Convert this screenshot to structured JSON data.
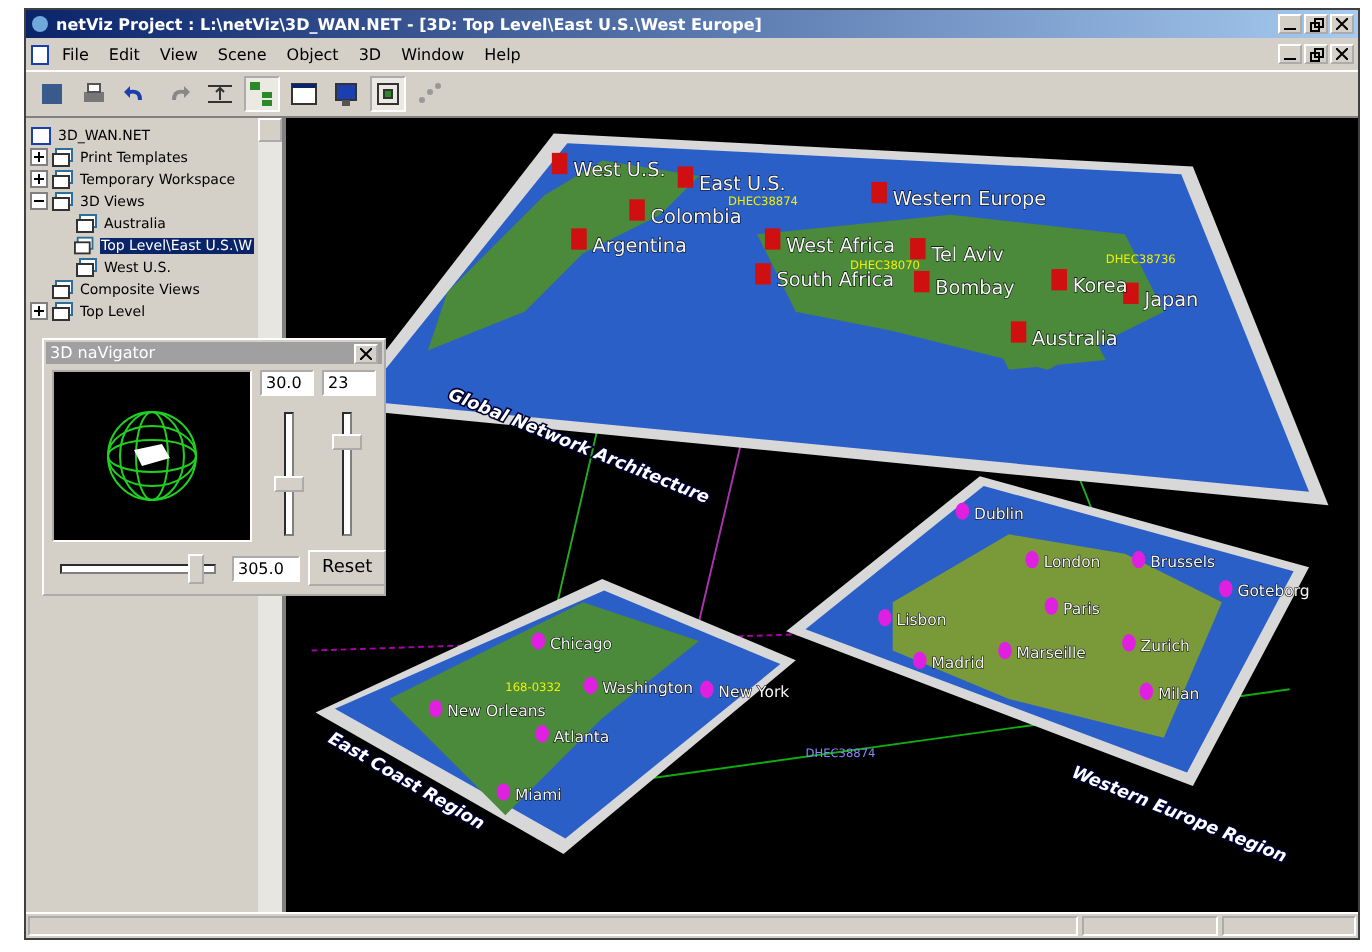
{
  "window": {
    "title": "netViz Project : L:\\netViz\\3D_WAN.NET - [3D: Top Level\\East U.S.\\West Europe]"
  },
  "menu": [
    "File",
    "Edit",
    "View",
    "Scene",
    "Object",
    "3D",
    "Window",
    "Help"
  ],
  "toolbar": [
    {
      "kind": "save",
      "pressed": false
    },
    {
      "kind": "print",
      "pressed": false
    },
    {
      "kind": "undo",
      "pressed": false
    },
    {
      "kind": "redo",
      "pressed": false
    },
    {
      "kind": "level",
      "pressed": false
    },
    {
      "kind": "tree",
      "pressed": true
    },
    {
      "kind": "panel",
      "pressed": false
    },
    {
      "kind": "monitor",
      "pressed": false
    },
    {
      "kind": "nodes",
      "pressed": true
    },
    {
      "kind": "scatter",
      "pressed": false
    }
  ],
  "tree": {
    "label": "3D_WAN.NET",
    "children": [
      {
        "label": "Print Templates",
        "expanded": false,
        "selected": false
      },
      {
        "label": "Temporary Workspace",
        "expanded": false,
        "selected": false
      },
      {
        "label": "3D Views",
        "expanded": true,
        "selected": false,
        "children": [
          {
            "label": "Australia",
            "selected": false
          },
          {
            "label": "Top Level\\East U.S.\\W",
            "selected": true
          },
          {
            "label": "West U.S.",
            "selected": false
          }
        ]
      },
      {
        "label": "Composite Views",
        "selected": false
      },
      {
        "label": "Top Level",
        "expanded": false,
        "selected": false
      }
    ]
  },
  "navigator": {
    "title": "3D naVigator",
    "field_1": "30.0",
    "field_2": "23",
    "field_3": "305.0",
    "slider_1": {
      "level": 0.4
    },
    "slider_2": {
      "level": 0.75
    },
    "slider_3": {
      "level": 0.87
    },
    "reset": "Reset"
  },
  "maps": [
    {
      "title": "Global Network Architecture",
      "labels": [
        {
          "kind": "city",
          "text": "West U.S."
        },
        {
          "kind": "city",
          "text": "East U.S."
        },
        {
          "kind": "city",
          "text": "Colombia"
        },
        {
          "kind": "city",
          "text": "Argentina"
        },
        {
          "kind": "city",
          "text": "Western Europe"
        },
        {
          "kind": "city",
          "text": "West Africa"
        },
        {
          "kind": "city",
          "text": "Tel Aviv"
        },
        {
          "kind": "city",
          "text": "South Africa"
        },
        {
          "kind": "city",
          "text": "Bombay"
        },
        {
          "kind": "city",
          "text": "Korea"
        },
        {
          "kind": "city",
          "text": "Japan"
        },
        {
          "kind": "city",
          "text": "Australia"
        },
        {
          "kind": "link",
          "text": "DHEC38874"
        },
        {
          "kind": "link",
          "text": "DHEC38070"
        },
        {
          "kind": "link",
          "text": "DHEC38736"
        }
      ]
    },
    {
      "title": "Western Europe Region",
      "labels": [
        {
          "kind": "city",
          "text": "Dublin"
        },
        {
          "kind": "city",
          "text": "London"
        },
        {
          "kind": "city",
          "text": "Brussels"
        },
        {
          "kind": "city",
          "text": "Goteborg"
        },
        {
          "kind": "city",
          "text": "Lisbon"
        },
        {
          "kind": "city",
          "text": "Paris"
        },
        {
          "kind": "city",
          "text": "Zurich"
        },
        {
          "kind": "city",
          "text": "Madrid"
        },
        {
          "kind": "city",
          "text": "Marseille"
        },
        {
          "kind": "city",
          "text": "Milan"
        }
      ]
    },
    {
      "title": "East Coast Region",
      "labels": [
        {
          "kind": "city",
          "text": "Chicago"
        },
        {
          "kind": "link",
          "text": "168-0332"
        },
        {
          "kind": "city",
          "text": "Washington"
        },
        {
          "kind": "city",
          "text": "New York"
        },
        {
          "kind": "city",
          "text": "New Orleans"
        },
        {
          "kind": "city",
          "text": "Atlanta"
        },
        {
          "kind": "city",
          "text": "Miami"
        }
      ]
    }
  ],
  "canvas_links": [
    "DHEC38874"
  ]
}
